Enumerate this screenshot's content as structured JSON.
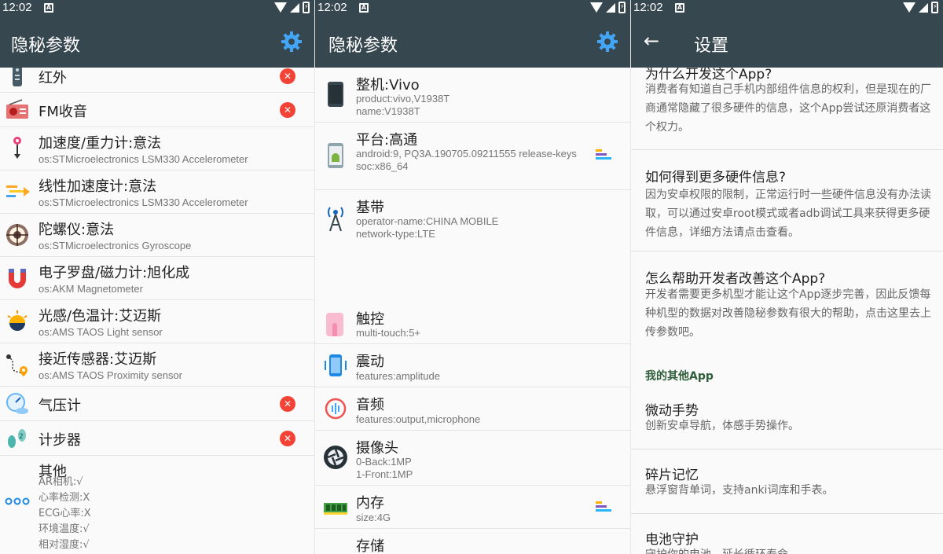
{
  "status": {
    "time": "12:02",
    "notif_glyph": "A",
    "battery_glyph": "⚡"
  },
  "panel1": {
    "title": "隐秘参数",
    "rows": [
      {
        "title": "红外",
        "sub": "",
        "remove": true
      },
      {
        "title": "FM收音",
        "sub": "",
        "remove": true
      },
      {
        "title": "加速度/重力计:意法",
        "sub": "os:STMicroelectronics LSM330 Accelerometer"
      },
      {
        "title": "线性加速度计:意法",
        "sub": "os:STMicroelectronics LSM330 Accelerometer"
      },
      {
        "title": "陀螺仪:意法",
        "sub": "os:STMicroelectronics Gyroscope"
      },
      {
        "title": "电子罗盘/磁力计:旭化成",
        "sub": "os:AKM Magnetometer"
      },
      {
        "title": "光感/色温计:艾迈斯",
        "sub": "os:AMS TAOS Light sensor"
      },
      {
        "title": "接近传感器:艾迈斯",
        "sub": "os:AMS TAOS Proximity sensor"
      },
      {
        "title": "气压计",
        "sub": "",
        "remove": true
      },
      {
        "title": "计步器",
        "sub": "",
        "remove": true
      }
    ],
    "other": {
      "title": "其他",
      "lines": [
        "AR相机:√",
        "心率检测:X",
        "ECG心率:X",
        "环境温度:√",
        "相对湿度:√"
      ]
    },
    "remove_glyph": "✕"
  },
  "panel2": {
    "title": "隐秘参数",
    "rows": [
      {
        "title": "整机:Vivo",
        "sub": "product:vivo,V1938T\nname:V1938T"
      },
      {
        "title": "平台:高通",
        "sub": "android:9, PQ3A.190705.09211555 release-keys\nsoc:x86_64",
        "bars": true
      },
      {
        "title": "基带",
        "sub": "operator-name:CHINA MOBILE\nnetwork-type:LTE"
      },
      {
        "title": "触控",
        "sub": "multi-touch:5+"
      },
      {
        "title": "震动",
        "sub": "features:amplitude"
      },
      {
        "title": "音频",
        "sub": "features:output,microphone"
      },
      {
        "title": "摄像头",
        "sub": "0-Back:1MP\n1-Front:1MP"
      },
      {
        "title": "内存",
        "sub": "size:4G",
        "bars": true
      },
      {
        "title": "存储",
        "sub": ""
      }
    ]
  },
  "panel3": {
    "title": "设置",
    "back_glyph": "←",
    "items": [
      {
        "title": "为什么开发这个App?",
        "desc": "消费者有知道自己手机内部组件信息的权利，但是现在的厂商通常隐藏了很多硬件的信息，这个App尝试还原消费者这个权力。"
      },
      {
        "title": "如何得到更多硬件信息?",
        "desc": "因为安卓权限的限制，正常运行时一些硬件信息没有办法读取，可以通过安卓root模式或者adb调试工具来获得更多硬件信息，详细方法请点击查看。"
      },
      {
        "title": "怎么帮助开发者改善这个App?",
        "desc": "开发者需要更多机型才能让这个App逐步完善，因此反馈每种机型的数据对改善隐秘参数有很大的帮助，点击这里去上传参数吧。"
      }
    ],
    "category": "我的其他App",
    "apps": [
      {
        "title": "微动手势",
        "desc": "创新安卓导航，体感手势操作。"
      },
      {
        "title": "碎片记忆",
        "desc": "悬浮窗背单词，支持anki词库和手表。"
      },
      {
        "title": "电池守护",
        "desc": "守护你的电池，延长循环寿命"
      }
    ]
  },
  "colors": {
    "appbar": "#37474f",
    "remove": "#f44336",
    "category": "#2e5d3a"
  }
}
